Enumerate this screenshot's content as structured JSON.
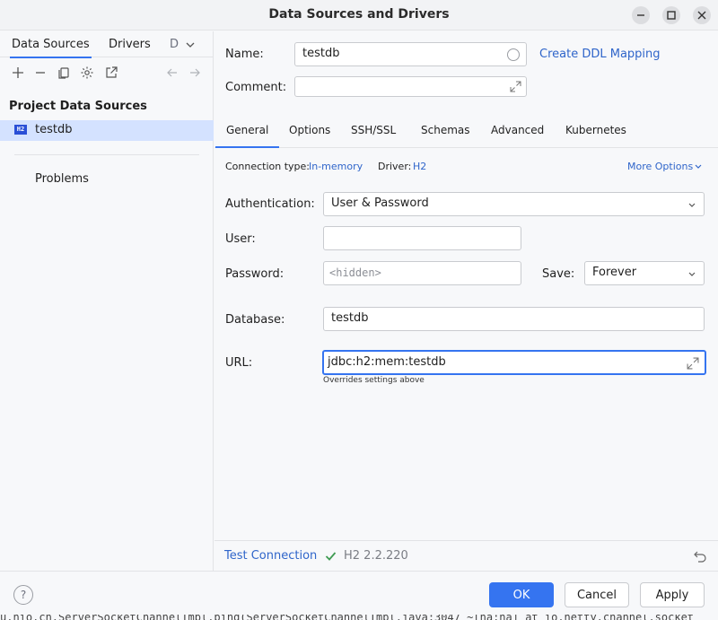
{
  "window": {
    "title": "Data Sources and Drivers"
  },
  "left": {
    "tabs": [
      {
        "label": "Data Sources"
      },
      {
        "label": "Drivers"
      },
      {
        "label": "D"
      }
    ],
    "section_title": "Project Data Sources",
    "data_source": {
      "badge": "H2",
      "label": "testdb"
    },
    "problems_label": "Problems"
  },
  "form": {
    "name_label": "Name:",
    "name_value": "testdb",
    "create_ddl_link": "Create DDL Mapping",
    "comment_label": "Comment:",
    "comment_value": ""
  },
  "tabs": [
    {
      "label": "General"
    },
    {
      "label": "Options"
    },
    {
      "label": "SSH/SSL"
    },
    {
      "label": "Schemas"
    },
    {
      "label": "Advanced"
    },
    {
      "label": "Kubernetes"
    }
  ],
  "general": {
    "connection_type_label": "Connection type:",
    "connection_type_value": "In-memory",
    "driver_label": "Driver:",
    "driver_value": "H2",
    "more_options": "More Options",
    "auth_label": "Authentication:",
    "auth_value": "User & Password",
    "user_label": "User:",
    "user_value": "",
    "password_label": "Password:",
    "password_placeholder": "<hidden>",
    "save_label": "Save:",
    "save_value": "Forever",
    "database_label": "Database:",
    "database_value": "testdb",
    "url_label": "URL:",
    "url_value": "jdbc:h2:mem:testdb",
    "url_hint": "Overrides settings above"
  },
  "footer": {
    "test_connection": "Test Connection",
    "driver_version": "H2 2.2.220"
  },
  "buttons": {
    "ok": "OK",
    "cancel": "Cancel",
    "apply": "Apply",
    "help": "?"
  },
  "background_text": "u.nio.ch.ServerSocketChannelImpl.bind(ServerSocketChannelImpl.java:3047 ~[na:na] at io.netty.channel.socket"
}
